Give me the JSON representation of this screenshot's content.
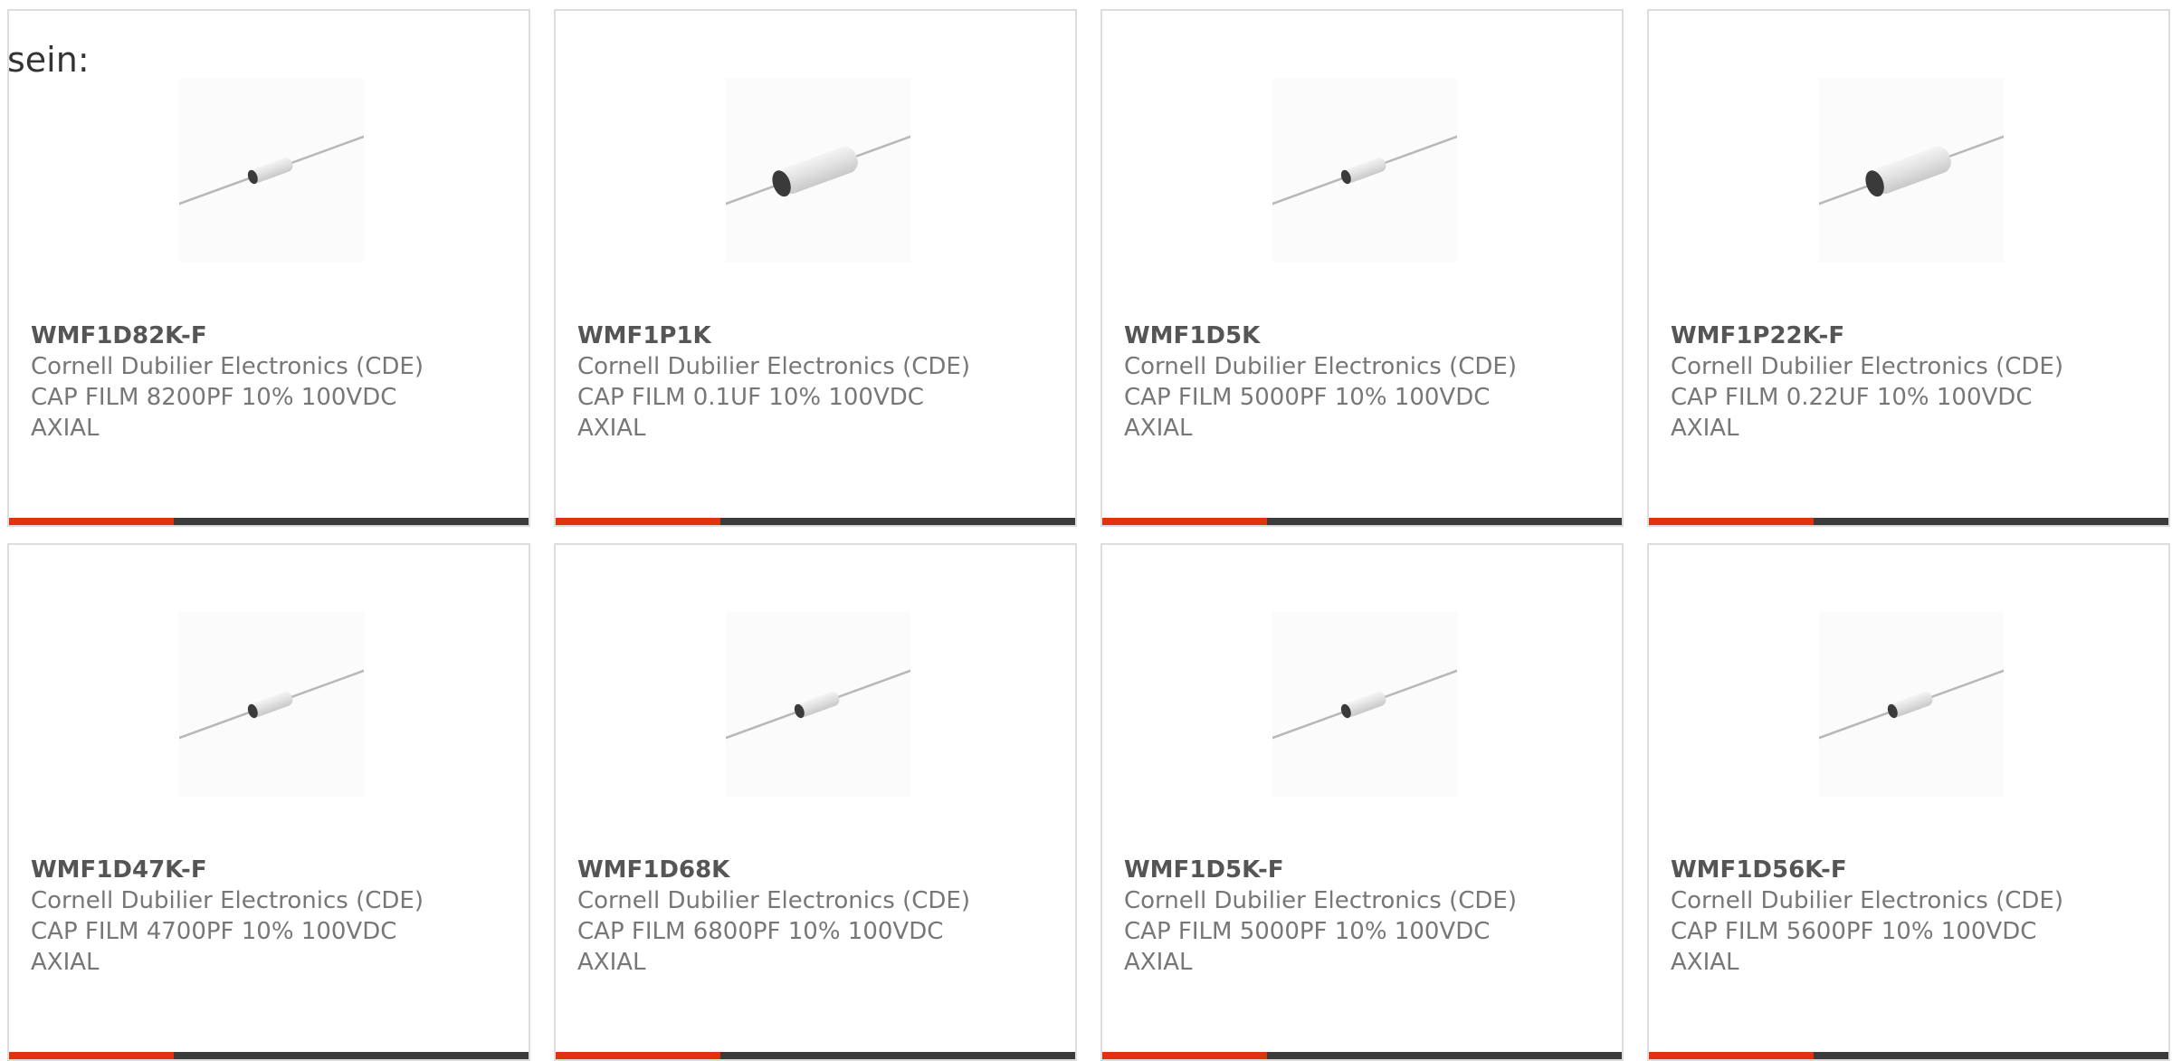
{
  "intro_text": "sein:",
  "colors": {
    "accent": "#e0330d",
    "bar": "#3b3b3b",
    "border": "#dddddd",
    "text": "#777777",
    "title": "#555555"
  },
  "products": [
    {
      "part_number": "WMF1D82K-F",
      "manufacturer": "Cornell Dubilier Electronics (CDE)",
      "description": "CAP FILM 8200PF 10% 100VDC",
      "package": "AXIAL",
      "image_icon": "axial-film-capacitor-icon",
      "body_size": "small"
    },
    {
      "part_number": "WMF1P1K",
      "manufacturer": "Cornell Dubilier Electronics (CDE)",
      "description": "CAP FILM 0.1UF 10% 100VDC",
      "package": "AXIAL",
      "image_icon": "axial-film-capacitor-icon",
      "body_size": "large"
    },
    {
      "part_number": "WMF1D5K",
      "manufacturer": "Cornell Dubilier Electronics (CDE)",
      "description": "CAP FILM 5000PF 10% 100VDC",
      "package": "AXIAL",
      "image_icon": "axial-film-capacitor-icon",
      "body_size": "small"
    },
    {
      "part_number": "WMF1P22K-F",
      "manufacturer": "Cornell Dubilier Electronics (CDE)",
      "description": "CAP FILM 0.22UF 10% 100VDC",
      "package": "AXIAL",
      "image_icon": "axial-film-capacitor-icon",
      "body_size": "large"
    },
    {
      "part_number": "WMF1D47K-F",
      "manufacturer": "Cornell Dubilier Electronics (CDE)",
      "description": "CAP FILM 4700PF 10% 100VDC",
      "package": "AXIAL",
      "image_icon": "axial-film-capacitor-icon",
      "body_size": "small"
    },
    {
      "part_number": "WMF1D68K",
      "manufacturer": "Cornell Dubilier Electronics (CDE)",
      "description": "CAP FILM 6800PF 10% 100VDC",
      "package": "AXIAL",
      "image_icon": "axial-film-capacitor-icon",
      "body_size": "small"
    },
    {
      "part_number": "WMF1D5K-F",
      "manufacturer": "Cornell Dubilier Electronics (CDE)",
      "description": "CAP FILM 5000PF 10% 100VDC",
      "package": "AXIAL",
      "image_icon": "axial-film-capacitor-icon",
      "body_size": "small"
    },
    {
      "part_number": "WMF1D56K-F",
      "manufacturer": "Cornell Dubilier Electronics (CDE)",
      "description": "CAP FILM 5600PF 10% 100VDC",
      "package": "AXIAL",
      "image_icon": "axial-film-capacitor-icon",
      "body_size": "small"
    }
  ]
}
